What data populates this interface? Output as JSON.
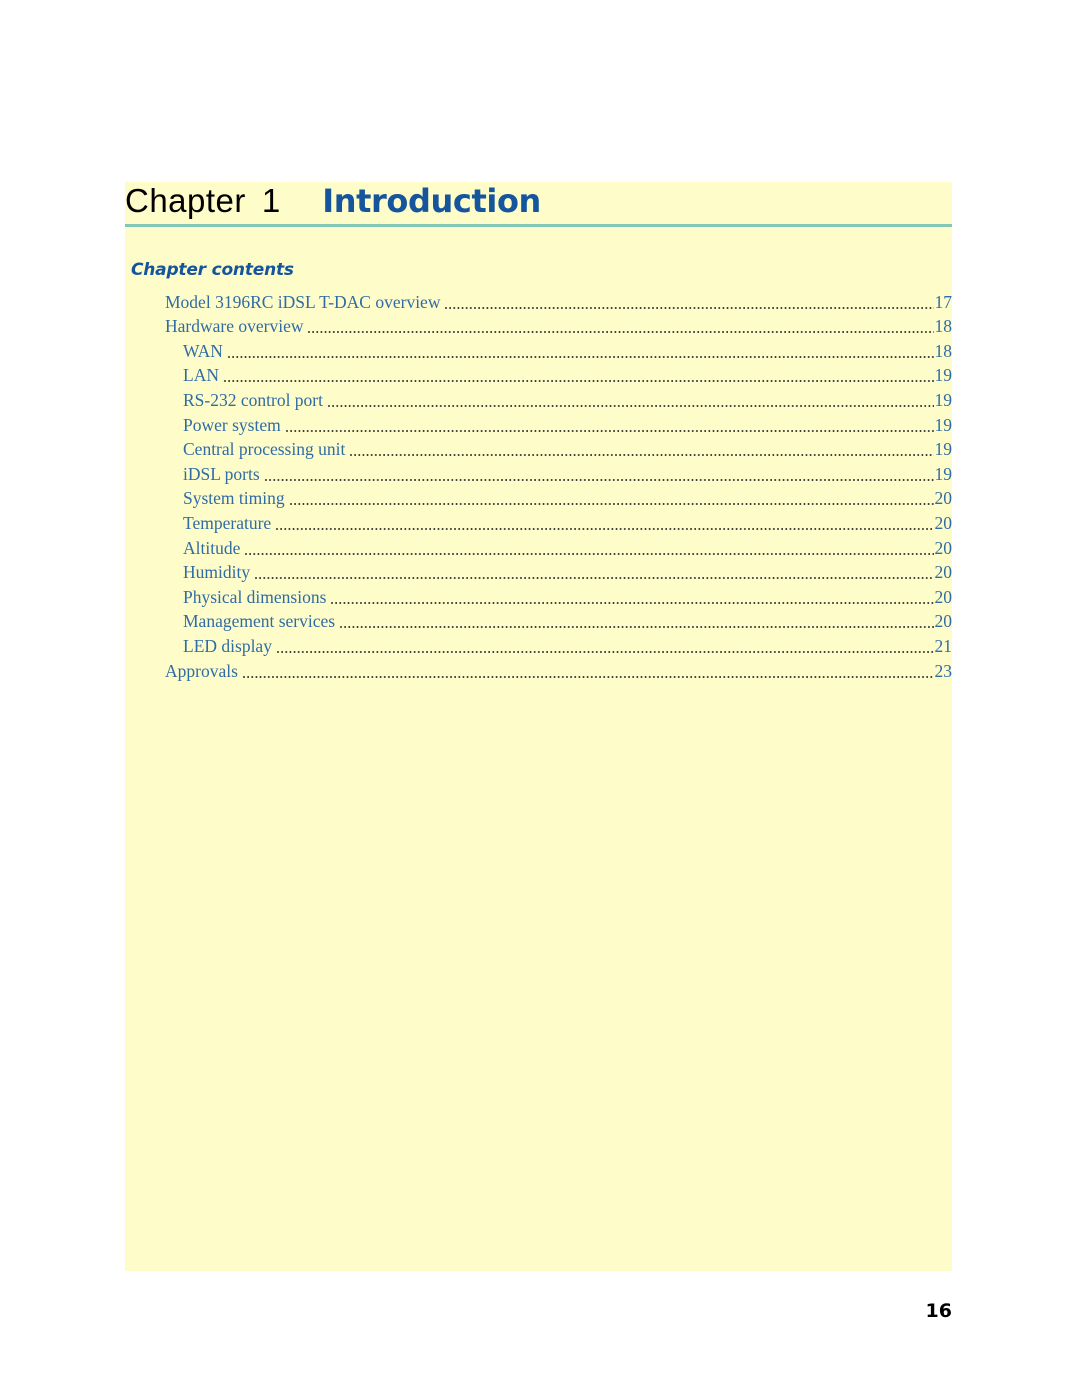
{
  "page": {
    "number": "16",
    "background_color": "#ffffff",
    "panel_color": "#fefcc8",
    "rule_color": "#85c7b6",
    "accent_blue": "#14559e",
    "toc_text_color": "#2f6ca6"
  },
  "header": {
    "chapter_word": "Chapter",
    "chapter_number": "1",
    "chapter_title": "Introduction"
  },
  "contents": {
    "heading": "Chapter contents",
    "entries": [
      {
        "label": "Model 3196RC iDSL T-DAC overview",
        "page": "17",
        "level": 1
      },
      {
        "label": "Hardware overview",
        "page": "18",
        "level": 1
      },
      {
        "label": "WAN",
        "page": "18",
        "level": 2
      },
      {
        "label": "LAN",
        "page": "19",
        "level": 2
      },
      {
        "label": "RS-232 control port",
        "page": "19",
        "level": 2
      },
      {
        "label": "Power system",
        "page": "19",
        "level": 2
      },
      {
        "label": "Central processing unit",
        "page": "19",
        "level": 2
      },
      {
        "label": "iDSL ports",
        "page": "19",
        "level": 2
      },
      {
        "label": "System timing",
        "page": "20",
        "level": 2
      },
      {
        "label": "Temperature",
        "page": "20",
        "level": 2
      },
      {
        "label": "Altitude",
        "page": "20",
        "level": 2
      },
      {
        "label": "Humidity",
        "page": "20",
        "level": 2
      },
      {
        "label": "Physical dimensions",
        "page": "20",
        "level": 2
      },
      {
        "label": "Management services",
        "page": "20",
        "level": 2
      },
      {
        "label": "LED display",
        "page": "21",
        "level": 2
      },
      {
        "label": "Approvals",
        "page": "23",
        "level": 1
      }
    ]
  }
}
